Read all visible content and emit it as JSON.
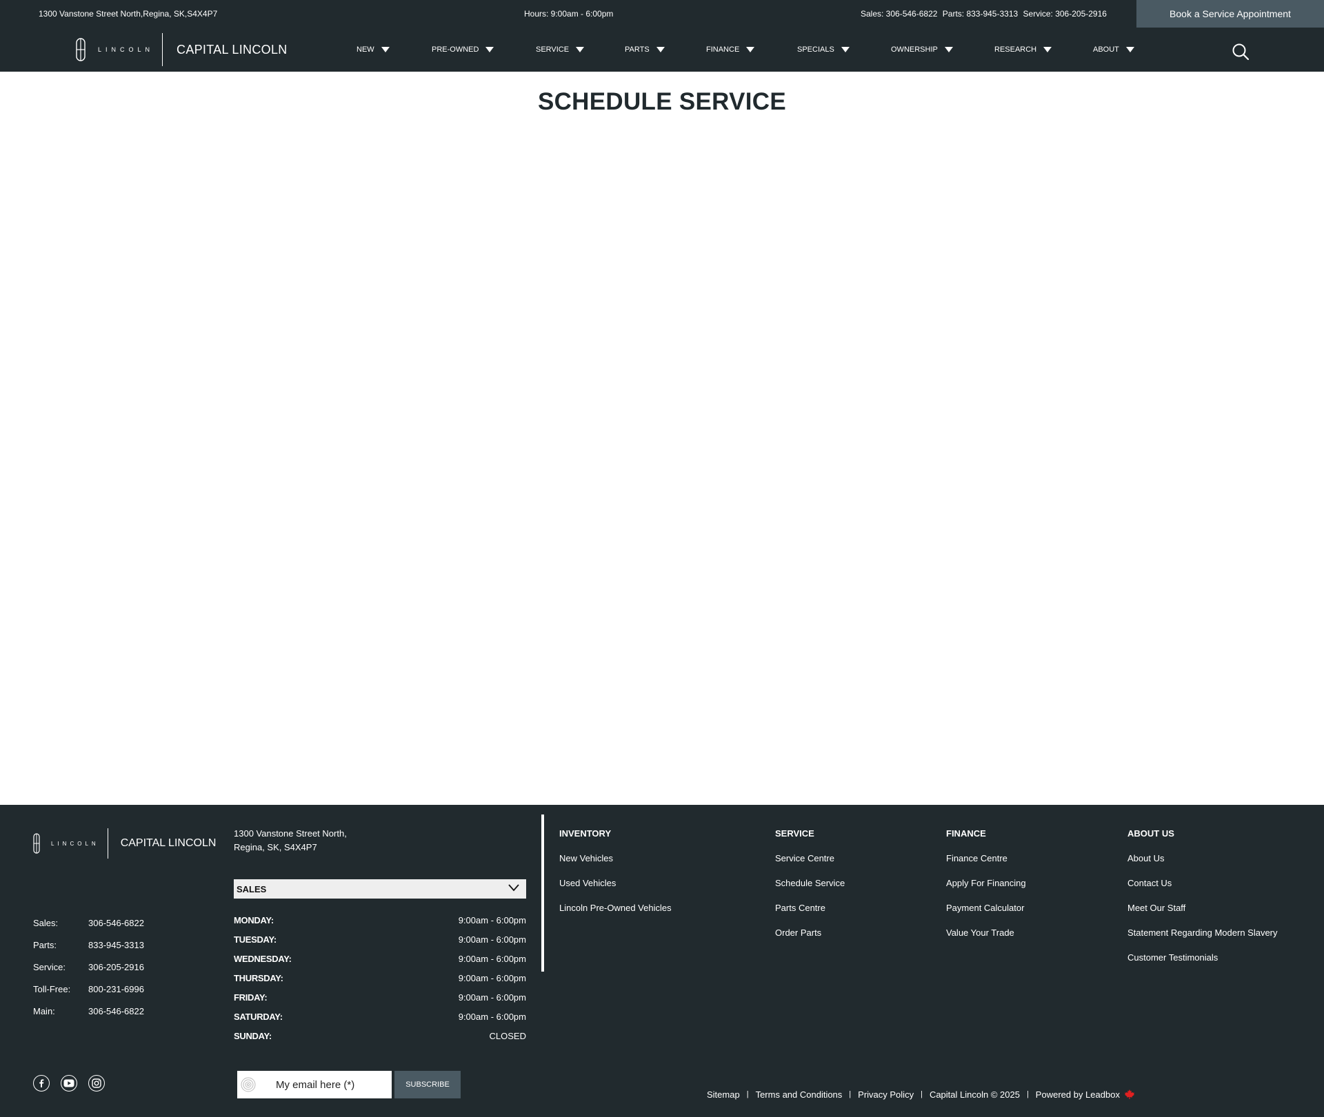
{
  "topbar": {
    "address": "1300 Vanstone Street North,Regina, SK,S4X4P7",
    "hours": "Hours: 9:00am - 6:00pm",
    "sales": "Sales: 306-546-6822",
    "parts": "Parts: 833-945-3313",
    "service": "Service: 306-205-2916",
    "book_button": "Book a Service Appointment"
  },
  "brand": {
    "wordmark": "LINCOLN",
    "dealer": "CAPITAL LINCOLN"
  },
  "nav": {
    "items": [
      "NEW",
      "PRE-OWNED",
      "SERVICE",
      "PARTS",
      "FINANCE",
      "SPECIALS",
      "OWNERSHIP",
      "RESEARCH",
      "ABOUT"
    ],
    "search_icon": "search-icon"
  },
  "main": {
    "title": "SCHEDULE SERVICE"
  },
  "footer": {
    "address_line1": "1300 Vanstone Street North,",
    "address_line2": "Regina, SK, S4X4P7",
    "contacts": [
      {
        "label": "Sales:",
        "value": "306-546-6822"
      },
      {
        "label": "Parts:",
        "value": "833-945-3313"
      },
      {
        "label": "Service:",
        "value": "306-205-2916"
      },
      {
        "label": "Toll-Free:",
        "value": "800-231-6996"
      },
      {
        "label": "Main:",
        "value": "306-546-6822"
      }
    ],
    "department_select": "SALES",
    "hours": [
      {
        "day": "MONDAY:",
        "time": "9:00am - 6:00pm"
      },
      {
        "day": "TUESDAY:",
        "time": "9:00am - 6:00pm"
      },
      {
        "day": "WEDNESDAY:",
        "time": "9:00am - 6:00pm"
      },
      {
        "day": "THURSDAY:",
        "time": "9:00am - 6:00pm"
      },
      {
        "day": "FRIDAY:",
        "time": "9:00am - 6:00pm"
      },
      {
        "day": "SATURDAY:",
        "time": "9:00am - 6:00pm"
      },
      {
        "day": "SUNDAY:",
        "time": "CLOSED"
      }
    ],
    "columns": [
      {
        "heading": "INVENTORY",
        "links": [
          "New Vehicles",
          "Used Vehicles",
          "Lincoln Pre-Owned Vehicles"
        ]
      },
      {
        "heading": "SERVICE",
        "links": [
          "Service Centre",
          "Schedule Service",
          "Parts Centre",
          "Order Parts"
        ]
      },
      {
        "heading": "FINANCE",
        "links": [
          "Finance Centre",
          "Apply For Financing",
          "Payment Calculator",
          "Value Your Trade"
        ]
      },
      {
        "heading": "ABOUT US",
        "links": [
          "About Us",
          "Contact Us",
          "Meet Our Staff",
          "Statement Regarding Modern Slavery",
          "Customer Testimonials"
        ]
      }
    ],
    "social": [
      "facebook-icon",
      "youtube-icon",
      "instagram-icon"
    ],
    "subscribe": {
      "placeholder": "My email here (*)",
      "button": "SUBSCRIBE"
    },
    "legal": {
      "sitemap": "Sitemap",
      "terms": "Terms and Conditions",
      "privacy": "Privacy Policy",
      "copyright": "Capital Lincoln © 2025",
      "powered": "Powered by Leadbox",
      "separator": "|"
    },
    "colors": {
      "dark": "#212a2e",
      "accent": "#4a5a63",
      "maple": "#e02020"
    }
  }
}
